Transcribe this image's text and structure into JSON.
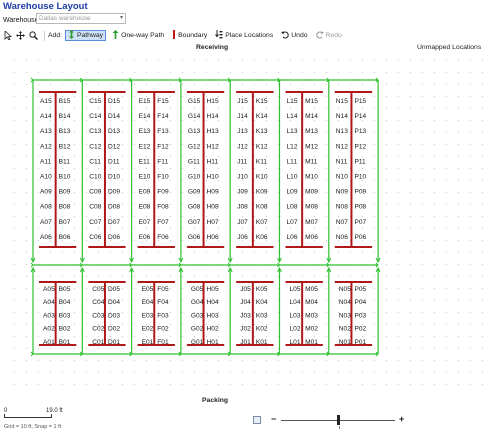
{
  "title": "Warehouse Layout",
  "warehouse": {
    "label": "Warehouse",
    "selected": "Dallas warehouse"
  },
  "toolbar": {
    "add_label": "Add:",
    "pathway": "Pathway",
    "one_way": "One-way Path",
    "boundary": "Boundary",
    "place_locations": "Place Locations",
    "undo": "Undo",
    "redo": "Redo"
  },
  "canvas": {
    "top_zone": "Receiving",
    "bottom_zone": "Packing",
    "unmapped": "Unmapped Locations"
  },
  "aisles": {
    "upper_rows": [
      "15",
      "14",
      "13",
      "12",
      "11",
      "10",
      "09",
      "08",
      "07",
      "06"
    ],
    "lower_rows": [
      "05",
      "04",
      "03",
      "02",
      "01"
    ],
    "pairs": [
      {
        "left": "A",
        "right": "B"
      },
      {
        "left": "C",
        "right": "D"
      },
      {
        "left": "E",
        "right": "F"
      },
      {
        "left": "G",
        "right": "H"
      },
      {
        "left": "J",
        "right": "K"
      },
      {
        "left": "L",
        "right": "M"
      },
      {
        "left": "N",
        "right": "P"
      }
    ]
  },
  "status": {
    "scale_start": "0",
    "scale_end": "19.0 ft",
    "grid_note": "Grid = 10 ft, Snap = 1 ft",
    "zoom_minus": "−",
    "zoom_plus": "+"
  },
  "colors": {
    "title": "#1f3fa8",
    "pathway": "#2fc02f",
    "rack": "#b01818",
    "active_btn_bg": "#cfe1f7"
  }
}
